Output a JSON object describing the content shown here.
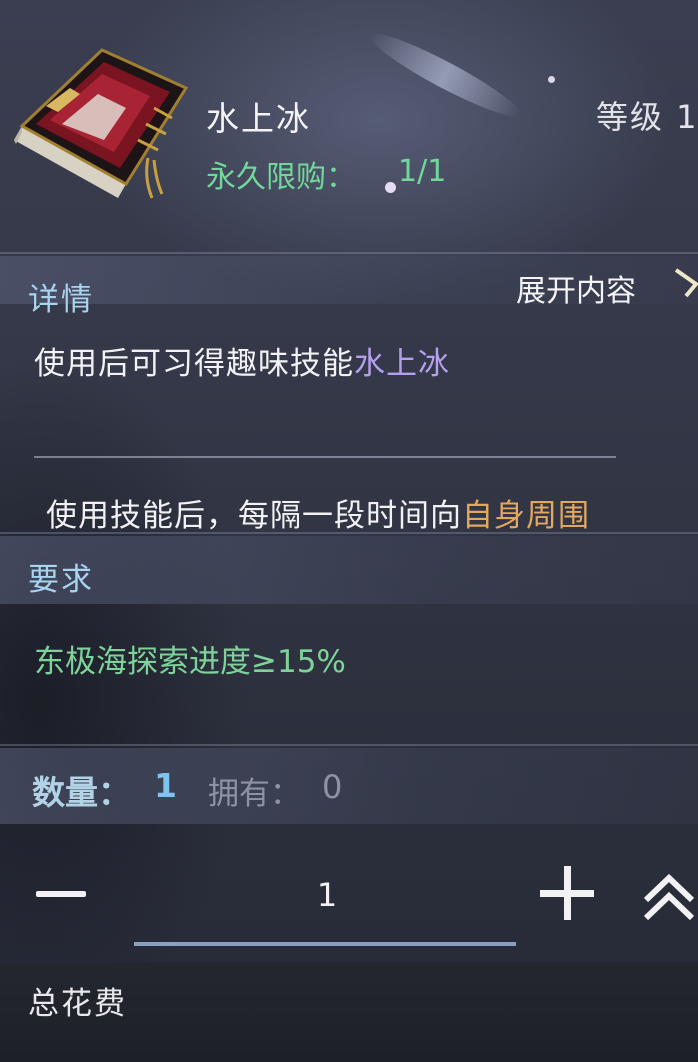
{
  "item": {
    "name": "水上冰",
    "level_text": "等级 1",
    "limit_label": "永久限购：",
    "limit_value": "1/1",
    "icon": "skill-book-icon"
  },
  "details": {
    "title": "详情",
    "expand_label": "展开内容",
    "line1_prefix": "使用后可习得趣味技能",
    "line1_skill": "水上冰",
    "line2_prefix": "使用技能后，每隔一段时间向",
    "line2_highlight": "自身周围"
  },
  "requirements": {
    "title": "要求",
    "text": "东极海探索进度≥15%"
  },
  "quantity": {
    "label": "数量：",
    "value": "1",
    "own_label": "拥有：",
    "own_value": "0"
  },
  "stepper": {
    "value": "1",
    "minus_icon": "minus-icon",
    "plus_icon": "plus-icon",
    "max_icon": "double-chevron-up-icon"
  },
  "cost": {
    "label": "总花费"
  },
  "colors": {
    "green": "#72d89a",
    "purple": "#b4a0ee",
    "gold": "#e2a860",
    "section_title": "#a8d4ee"
  }
}
